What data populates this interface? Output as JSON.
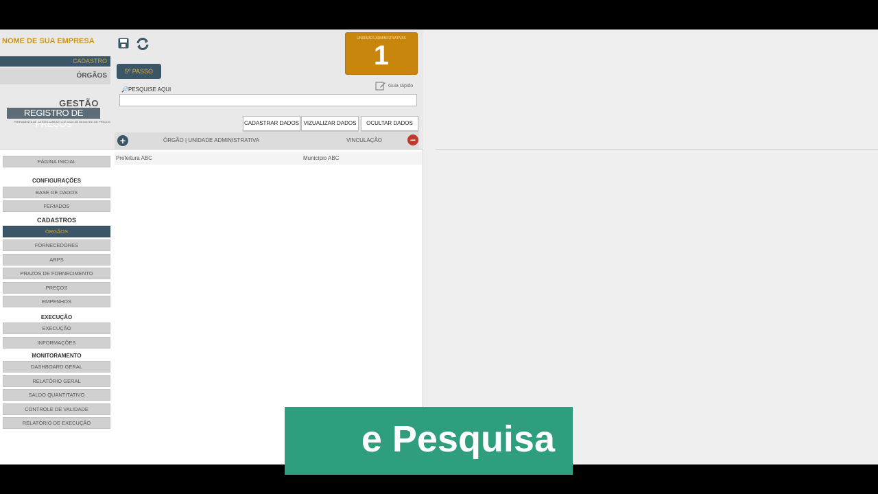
{
  "header": {
    "company": "NOME DE SUA EMPRESA",
    "section": "CADASTRO",
    "subsection": "ÓRGÃOS",
    "logo_line1": "GESTÃO",
    "logo_line2": "REGISTRO DE PREÇOS",
    "logo_line3": "FERRAMENTA DE GERENCIAMENTO DE ATAS DE REGISTRO DE PREÇOS",
    "step_label": "5º PASSO",
    "search_label": "PESQUISE AQUI",
    "search_value": "",
    "counter_label": "UNIDADES ADMINISTRATIVAS",
    "counter_value": "1",
    "guide_label": "Guia rápido"
  },
  "actions": {
    "register": "CADASTRAR DADOS",
    "view": "VIZUALIZAR DADOS",
    "hide": "OCULTAR DADOS"
  },
  "table": {
    "col1": "ÓRGÃO | UNIDADE ADMINISTRATIVA",
    "col2": "VINCULAÇÃO",
    "rows": [
      {
        "orgao": "Prefeitura ABC",
        "vinculacao": "Município ABC"
      }
    ]
  },
  "nav": {
    "home": "PÁGINA INICIAL",
    "config_header": "CONFIGURAÇÕES",
    "database": "BASE DE DADOS",
    "holidays": "FERIADOS",
    "cadastros_header": "CADASTROS",
    "orgaos": "ÓRGÃOS",
    "suppliers": "FORNECEDORES",
    "arps": "ARPS",
    "deadlines": "PRAZOS DE FORNECIMENTO",
    "prices": "PREÇOS",
    "commitments": "EMPENHOS",
    "exec_header": "EXECUÇÃO",
    "execution": "EXECUÇÃO",
    "information": "INFORMAÇÕES",
    "monitor_header": "MONITORAMENTO",
    "dashboard": "DASHBOARD GERAL",
    "report": "RELATÓRIO GERAL",
    "balance": "SALDO QUANTITATIVO",
    "validity": "CONTROLE DE VALIDADE",
    "exec_report": "RELATÓRIO DE EXECUÇÃO"
  },
  "banner": {
    "text": "e Pesquisa"
  },
  "colors": {
    "navy": "#3a5667",
    "gold": "#d4a62a",
    "orange": "#c8860c",
    "banner": "#2e9e7e"
  }
}
